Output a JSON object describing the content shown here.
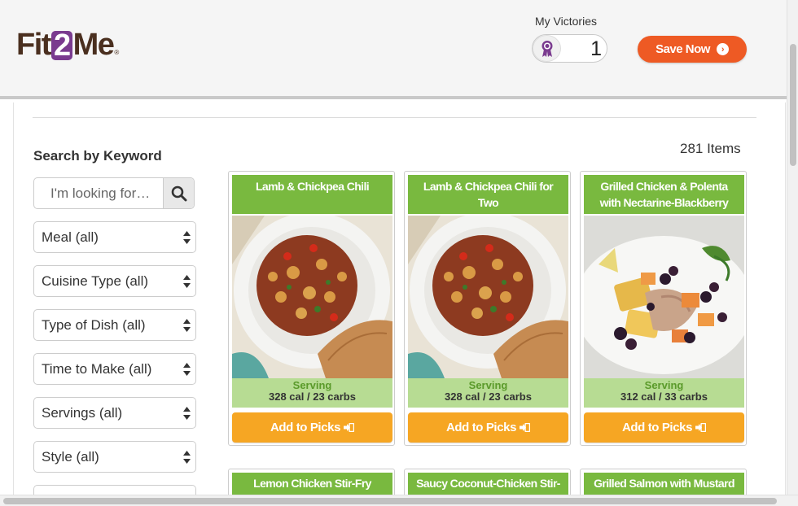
{
  "header": {
    "logo": {
      "part1": "Fit",
      "part2": "2",
      "part3": "Me",
      "reg": "®"
    },
    "victories": {
      "label": "My Victories",
      "count": "1",
      "icon": "ribbon-icon"
    },
    "save_button": {
      "label": "Save Now",
      "icon": "chevron-right-circle-icon"
    }
  },
  "sidebar": {
    "heading": "Search by Keyword",
    "search_placeholder": "I'm looking for…",
    "filters": [
      "Meal (all)",
      "Cuisine Type (all)",
      "Type of Dish (all)",
      "Time to Make (all)",
      "Servings (all)",
      "Style (all)"
    ]
  },
  "results": {
    "count_label": "281 Items",
    "recipes": [
      {
        "title": "Lamb & Chickpea Chili",
        "serving_label": "Serving",
        "nutrition": "328 cal / 23 carbs",
        "add_label": "Add to Picks"
      },
      {
        "title": "Lamb & Chickpea Chili for Two",
        "serving_label": "Serving",
        "nutrition": "328 cal / 23 carbs",
        "add_label": "Add to Picks"
      },
      {
        "title": "Grilled Chicken & Polenta with Nectarine-Blackberry Salsa",
        "serving_label": "Serving",
        "nutrition": "312 cal / 33 carbs",
        "add_label": "Add to Picks"
      }
    ],
    "next_row_titles": [
      "Lemon Chicken Stir-Fry",
      "Saucy Coconut-Chicken Stir-",
      "Grilled Salmon with Mustard"
    ]
  },
  "colors": {
    "brand_brown": "#4a2f1f",
    "brand_purple": "#7a3b8f",
    "save_orange": "#ee5a24",
    "card_green": "#79b93f",
    "info_green": "#b7dc93",
    "add_orange": "#f6a623"
  }
}
